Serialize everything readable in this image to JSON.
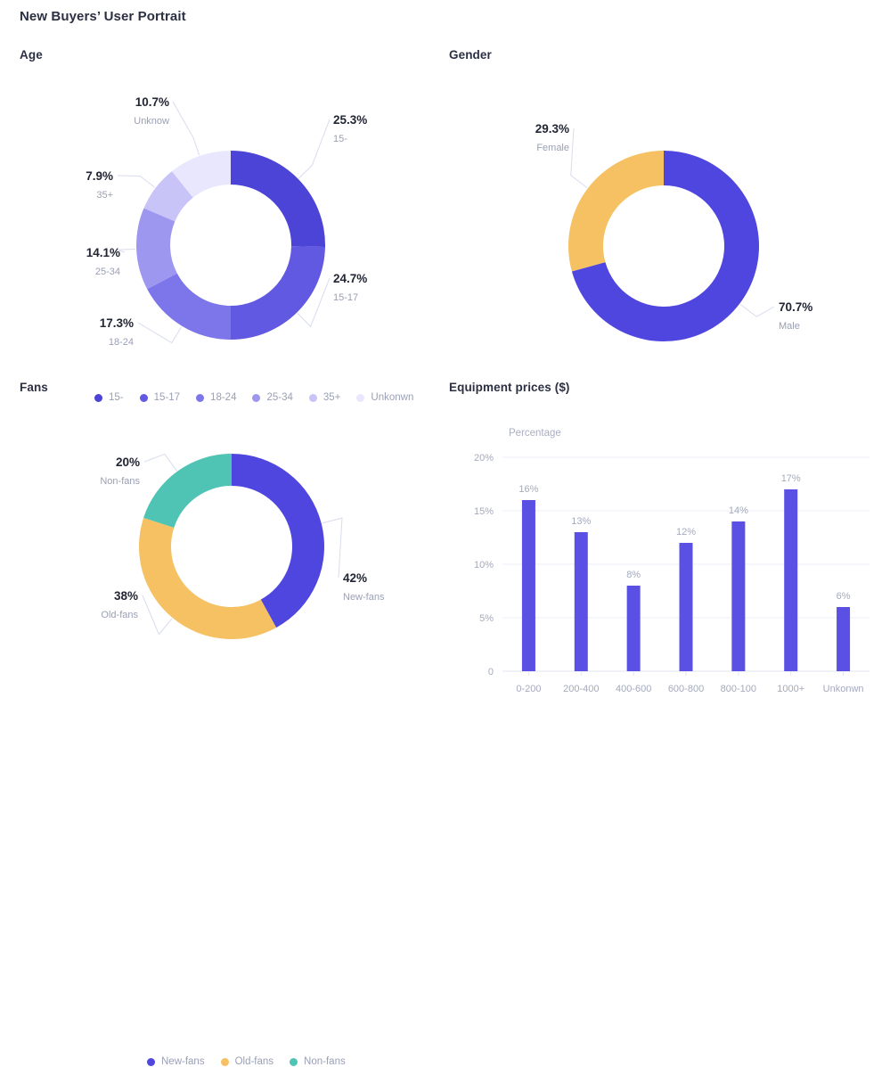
{
  "page": {
    "title": "New Buyers’ User Portrait"
  },
  "panels": {
    "age": {
      "title": "Age"
    },
    "gender": {
      "title": "Gender"
    },
    "fans": {
      "title": "Fans"
    },
    "equipment": {
      "title": "Equipment prices ($)"
    }
  },
  "colors": {
    "indigo": "#4b44d6",
    "indigo_2": "#5a51e0",
    "indigo_3": "#6f67e8",
    "indigo_4": "#8d86ee",
    "indigo_5": "#c3bff7",
    "indigo_6": "#e7e5fc",
    "amber": "#f5c濃"
  },
  "chart_data": [
    {
      "type": "pie",
      "id": "age-donut",
      "title": "Age",
      "donut": true,
      "categories": [
        "15-",
        "15-17",
        "18-24",
        "25-34",
        "35+",
        "Unknow"
      ],
      "values": [
        25.3,
        24.7,
        17.3,
        14.1,
        7.9,
        10.7
      ],
      "value_labels": [
        "25.3%",
        "24.7%",
        "17.3%",
        "14.1%",
        "7.9%",
        "10.7%"
      ],
      "colors": [
        "#4b44d6",
        "#6159e2",
        "#7d75ea",
        "#9d97f0",
        "#c8c4f8",
        "#e9e7fd"
      ],
      "legend": {
        "position": "bottom",
        "entries": [
          {
            "label": "15-",
            "color": "#4b44d6"
          },
          {
            "label": "15-17",
            "color": "#6159e2"
          },
          {
            "label": "18-24",
            "color": "#7d75ea"
          },
          {
            "label": "25-34",
            "color": "#9d97f0"
          },
          {
            "label": "35+",
            "color": "#c8c4f8"
          },
          {
            "label": "Unkonwn",
            "color": "#e9e7fd"
          }
        ]
      }
    },
    {
      "type": "pie",
      "id": "gender-donut",
      "title": "Gender",
      "donut": true,
      "categories": [
        "Male",
        "Female"
      ],
      "values": [
        70.7,
        29.3
      ],
      "value_labels": [
        "70.7%",
        "29.3%"
      ],
      "colors": [
        "#4f46e0",
        "#f5c163"
      ],
      "legend": {
        "position": "bottom",
        "entries": [
          {
            "label": "Male",
            "color": "#4f46e0"
          },
          {
            "label": "Female",
            "color": "#f5c163"
          }
        ]
      }
    },
    {
      "type": "pie",
      "id": "fans-donut",
      "title": "Fans",
      "donut": true,
      "categories": [
        "New-fans",
        "Old-fans",
        "Non-fans"
      ],
      "values": [
        42,
        38,
        20
      ],
      "value_labels": [
        "42%",
        "38%",
        "20%"
      ],
      "colors": [
        "#4f46e0",
        "#f5c163",
        "#4fc4b4"
      ],
      "legend": {
        "position": "bottom",
        "entries": [
          {
            "label": "New-fans",
            "color": "#4f46e0"
          },
          {
            "label": "Old-fans",
            "color": "#f5c163"
          },
          {
            "label": "Non-fans",
            "color": "#4fc4b4"
          }
        ]
      }
    },
    {
      "type": "bar",
      "id": "equipment-bar",
      "title": "Equipment prices ($)",
      "ylabel": "Percentage",
      "xlabel": "",
      "categories": [
        "0-200",
        "200-400",
        "400-600",
        "600-800",
        "800-100",
        "1000+",
        "Unkonwn"
      ],
      "values": [
        16,
        13,
        8,
        12,
        14,
        17,
        6
      ],
      "value_labels": [
        "16%",
        "13%",
        "8%",
        "12%",
        "14%",
        "17%",
        "6%"
      ],
      "ylim": [
        0,
        20
      ],
      "yticks": [
        0,
        5,
        10,
        15,
        20
      ],
      "ytick_labels": [
        "0",
        "5%",
        "10%",
        "15%",
        "20%"
      ],
      "grid": true,
      "bar_color": "#5a50e3",
      "legend": {
        "position": "none",
        "entries": []
      }
    }
  ]
}
